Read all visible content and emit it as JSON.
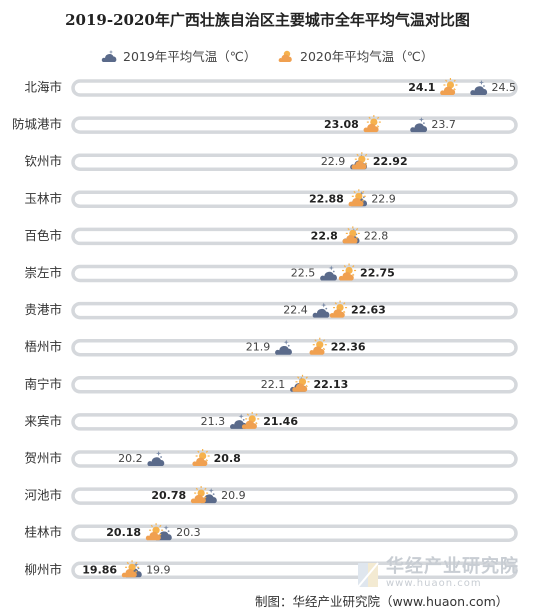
{
  "chart_data": {
    "type": "dot-plot",
    "title": "2019-2020年广西壮族自治区主要城市全年平均气温对比图",
    "xlim": [
      19.1,
      25
    ],
    "legend": {
      "placement": "top"
    },
    "series": [
      {
        "name": "2019年平均气温（℃）",
        "icon": "cloudy-night-icon",
        "color": "#5a6a8a",
        "values": [
          24.5,
          23.7,
          22.9,
          22.9,
          22.8,
          22.5,
          22.4,
          21.9,
          22.1,
          21.3,
          20.2,
          20.9,
          20.3,
          19.9
        ]
      },
      {
        "name": "2020年平均气温（℃）",
        "icon": "partly-sunny-icon",
        "color": "#f0a050",
        "values": [
          24.1,
          23.08,
          22.92,
          22.88,
          22.8,
          22.75,
          22.63,
          22.36,
          22.13,
          21.46,
          20.8,
          20.78,
          20.18,
          19.86
        ]
      }
    ],
    "categories": [
      "北海市",
      "防城港市",
      "钦州市",
      "玉林市",
      "百色市",
      "崇左市",
      "贵港市",
      "梧州市",
      "南宁市",
      "来宾市",
      "贺州市",
      "河池市",
      "桂林市",
      "柳州市"
    ],
    "labels_2019": [
      "24.5",
      "23.7",
      "22.9",
      "22.9",
      "22.8",
      "22.5",
      "22.4",
      "21.9",
      "22.1",
      "21.3",
      "20.2",
      "20.9",
      "20.3",
      "19.9"
    ],
    "labels_2020": [
      "24.1",
      "23.08",
      "22.92",
      "22.88",
      "22.8",
      "22.75",
      "22.63",
      "22.36",
      "22.13",
      "21.46",
      "20.8",
      "20.78",
      "20.18",
      "19.86"
    ]
  },
  "watermark": {
    "text": "华经产业研究院",
    "url": "www.huaon.com"
  },
  "source": "制图：华经产业研究院（www.huaon.com）"
}
